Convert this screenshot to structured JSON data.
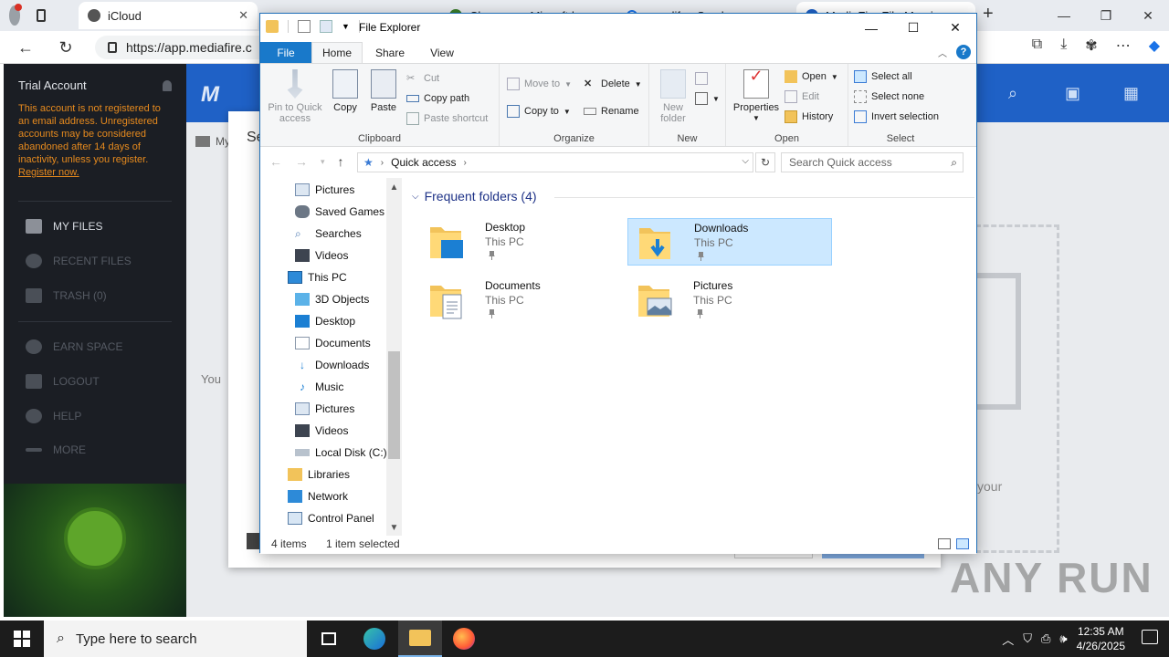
{
  "browser": {
    "tabs": [
      {
        "title": "iCloud"
      },
      {
        "title": "Cl.............. Micr...ft l..."
      },
      {
        "title": "... ...dif.... S.....l..."
      },
      {
        "title": "MediaFire File Ma...i..."
      }
    ],
    "url": "https://app.mediafire.c",
    "window_controls": [
      "—",
      "❐",
      "✕"
    ]
  },
  "mediafire": {
    "trial_account": "Trial Account",
    "warning": "This account is not registered to an email address. Unregistered accounts may be considered abandoned after 14 days of inactivity, unless you register.",
    "register_link": "Register now.",
    "nav": [
      {
        "label": "MY FILES",
        "icon": "folder-icon"
      },
      {
        "label": "RECENT FILES",
        "icon": "clock-icon"
      },
      {
        "label": "TRASH (0)",
        "icon": "trash-icon"
      },
      {
        "label": "EARN SPACE",
        "icon": "plus-icon"
      },
      {
        "label": "LOGOUT",
        "icon": "logout-icon"
      },
      {
        "label": "HELP",
        "icon": "help-icon"
      },
      {
        "label": "MORE",
        "icon": "more-icon"
      }
    ],
    "header_crumb": "My",
    "dialog_title": "Se",
    "dialog_text": "You",
    "right_text": "your"
  },
  "explorer": {
    "title": "File Explorer",
    "tabs": {
      "file": "File",
      "home": "Home",
      "share": "Share",
      "view": "View"
    },
    "ribbon": {
      "clipboard": {
        "label": "Clipboard",
        "pin": "Pin to Quick access",
        "copy": "Copy",
        "paste": "Paste",
        "cut": "Cut",
        "copy_path": "Copy path",
        "paste_shortcut": "Paste shortcut"
      },
      "organize": {
        "label": "Organize",
        "move_to": "Move to",
        "copy_to": "Copy to",
        "delete": "Delete",
        "rename": "Rename"
      },
      "new": {
        "label": "New",
        "new_folder": "New folder"
      },
      "open": {
        "label": "Open",
        "properties": "Properties",
        "open": "Open",
        "edit": "Edit",
        "history": "History"
      },
      "select": {
        "label": "Select",
        "select_all": "Select all",
        "select_none": "Select none",
        "invert": "Invert selection"
      }
    },
    "address": {
      "path": "Quick access",
      "search_placeholder": "Search Quick access"
    },
    "nav_pane": [
      {
        "label": "Pictures",
        "indent": 1
      },
      {
        "label": "Saved Games",
        "indent": 1
      },
      {
        "label": "Searches",
        "indent": 1
      },
      {
        "label": "Videos",
        "indent": 1
      },
      {
        "label": "This PC",
        "indent": 0
      },
      {
        "label": "3D Objects",
        "indent": 1
      },
      {
        "label": "Desktop",
        "indent": 1
      },
      {
        "label": "Documents",
        "indent": 1
      },
      {
        "label": "Downloads",
        "indent": 1
      },
      {
        "label": "Music",
        "indent": 1
      },
      {
        "label": "Pictures",
        "indent": 1
      },
      {
        "label": "Videos",
        "indent": 1
      },
      {
        "label": "Local Disk (C:)",
        "indent": 1
      },
      {
        "label": "Libraries",
        "indent": 0
      },
      {
        "label": "Network",
        "indent": 0
      },
      {
        "label": "Control Panel",
        "indent": 0
      }
    ],
    "section_title": "Frequent folders (4)",
    "folders": [
      {
        "name": "Desktop",
        "location": "This PC",
        "selected": false
      },
      {
        "name": "Downloads",
        "location": "This PC",
        "selected": true
      },
      {
        "name": "Documents",
        "location": "This PC",
        "selected": false
      },
      {
        "name": "Pictures",
        "location": "This PC",
        "selected": false
      }
    ],
    "status": {
      "items": "4 items",
      "selected": "1 item selected"
    }
  },
  "watermark": "ANY RUN",
  "taskbar": {
    "search_placeholder": "Type here to search",
    "time": "12:35 AM",
    "date": "4/26/2025"
  },
  "colors": {
    "explorer_accent": "#1979ca",
    "selection": "#cce8ff",
    "mediafire_blue": "#1f61c6",
    "mediafire_dark": "#1b1e24",
    "warning_orange": "#e68a1e"
  }
}
